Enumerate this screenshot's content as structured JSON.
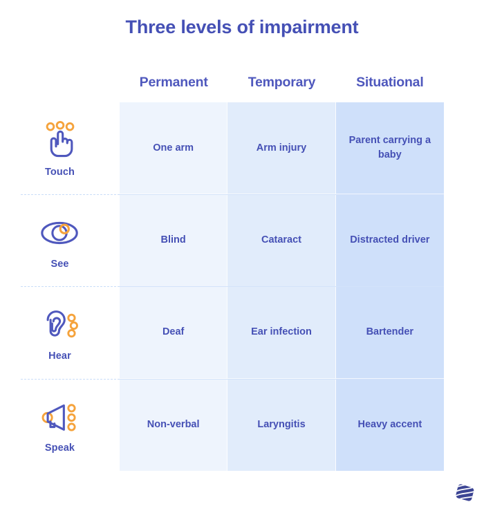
{
  "title": "Three levels of impairment",
  "colors": {
    "brand_purple": "#4550b5",
    "header_purple": "#4f58bd",
    "accent_orange": "#f5a33c",
    "col1_bg": "#eef4fd",
    "col2_bg": "#e1ecfb",
    "col3_bg": "#cfe0fa",
    "divider": "#c9ddf8",
    "logo": "#3c4594"
  },
  "columns": [
    {
      "label": "Permanent"
    },
    {
      "label": "Temporary"
    },
    {
      "label": "Situational"
    }
  ],
  "rows": [
    {
      "icon": "pointing-hand-icon",
      "label": "Touch",
      "cells": [
        "One arm",
        "Arm injury",
        "Parent carrying a baby"
      ]
    },
    {
      "icon": "eye-icon",
      "label": "See",
      "cells": [
        "Blind",
        "Cataract",
        "Distracted driver"
      ]
    },
    {
      "icon": "ear-icon",
      "label": "Hear",
      "cells": [
        "Deaf",
        "Ear infection",
        "Bartender"
      ]
    },
    {
      "icon": "megaphone-icon",
      "label": "Speak",
      "cells": [
        "Non-verbal",
        "Laryngitis",
        "Heavy accent"
      ]
    }
  ],
  "logo": {
    "name": "brand-logo"
  }
}
